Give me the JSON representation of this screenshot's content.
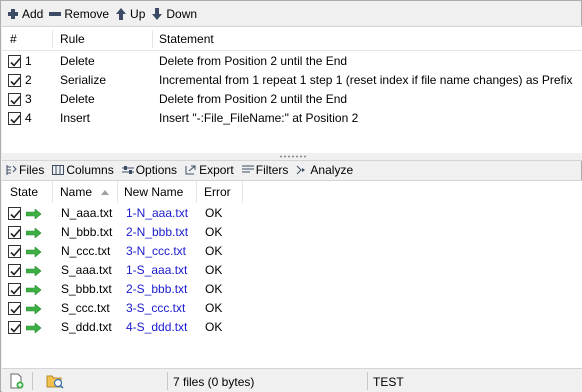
{
  "toolbar": {
    "add": "Add",
    "remove": "Remove",
    "up": "Up",
    "down": "Down"
  },
  "rules": {
    "columns": [
      "#",
      "Rule",
      "Statement"
    ],
    "rows": [
      {
        "num": "1",
        "rule": "Delete",
        "statement": "Delete from Position 2 until the End",
        "checked": true
      },
      {
        "num": "2",
        "rule": "Serialize",
        "statement": "Incremental from 1 repeat 1 step 1 (reset index if file name changes) as Prefix",
        "checked": true
      },
      {
        "num": "3",
        "rule": "Delete",
        "statement": "Delete from Position 2 until the End",
        "checked": true
      },
      {
        "num": "4",
        "rule": "Insert",
        "statement": "Insert \"-:File_FileName:\" at Position 2",
        "checked": true
      }
    ]
  },
  "files_tabs": {
    "files": "Files",
    "columns": "Columns",
    "options": "Options",
    "export": "Export",
    "filters": "Filters",
    "analyze": "Analyze"
  },
  "files": {
    "columns": [
      "State",
      "Name",
      "New Name",
      "Error"
    ],
    "rows": [
      {
        "name": "N_aaa.txt",
        "new_name": "1-N_aaa.txt",
        "error": "OK",
        "checked": true
      },
      {
        "name": "N_bbb.txt",
        "new_name": "2-N_bbb.txt",
        "error": "OK",
        "checked": true
      },
      {
        "name": "N_ccc.txt",
        "new_name": "3-N_ccc.txt",
        "error": "OK",
        "checked": true
      },
      {
        "name": "S_aaa.txt",
        "new_name": "1-S_aaa.txt",
        "error": "OK",
        "checked": true
      },
      {
        "name": "S_bbb.txt",
        "new_name": "2-S_bbb.txt",
        "error": "OK",
        "checked": true
      },
      {
        "name": "S_ccc.txt",
        "new_name": "3-S_ccc.txt",
        "error": "OK",
        "checked": true
      },
      {
        "name": "S_ddd.txt",
        "new_name": "4-S_ddd.txt",
        "error": "OK",
        "checked": true
      }
    ]
  },
  "status": {
    "count": "7 files (0 bytes)",
    "mode": "TEST"
  },
  "colors": {
    "new_name": "#1a1acf",
    "arrow_green": "#3cb043",
    "icon_navy": "#3a4b63"
  }
}
